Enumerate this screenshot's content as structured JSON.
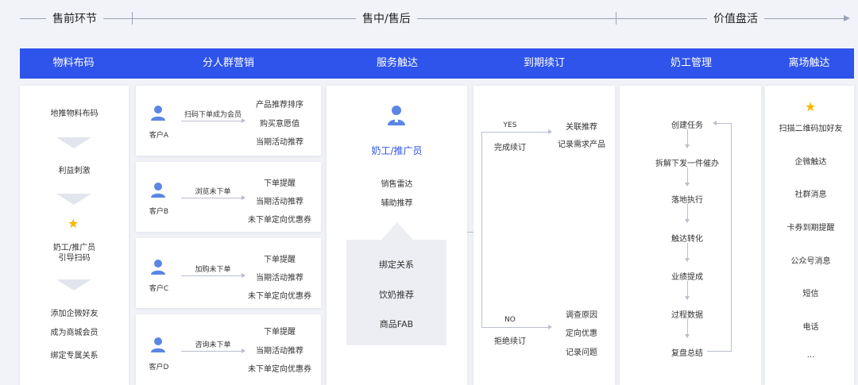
{
  "phases": {
    "pre": "售前环节",
    "mid": "售中/售后",
    "value": "价值盘活"
  },
  "headers": [
    "物料布码",
    "分人群营销",
    "服务触达",
    "到期续订",
    "奶工管理",
    "离场触达"
  ],
  "col1": {
    "step1": "地推物料布码",
    "step2": "利益刺激",
    "step3_line1": "奶工/推广员",
    "step3_line2": "引导扫码",
    "items": [
      "添加企微好友",
      "成为商城会员",
      "绑定专属关系"
    ]
  },
  "col2": {
    "groups": [
      {
        "customer": "客户A",
        "action": "扫码下单成为会员",
        "items": [
          "产品推荐排序",
          "购买意愿值",
          "当期活动推荐"
        ]
      },
      {
        "customer": "客户B",
        "action": "浏览未下单",
        "items": [
          "下单提醒",
          "当期活动推荐",
          "未下单定向优惠券"
        ]
      },
      {
        "customer": "客户C",
        "action": "加购未下单",
        "items": [
          "下单提醒",
          "当期活动推荐",
          "未下单定向优惠券"
        ]
      },
      {
        "customer": "客户D",
        "action": "咨询未下单",
        "items": [
          "下单提醒",
          "当期活动推荐",
          "未下单定向优惠券"
        ]
      }
    ]
  },
  "col3": {
    "role": "奶工/推广员",
    "items": [
      "销售雷达",
      "辅助推荐"
    ],
    "box_items": [
      "绑定关系",
      "饮奶推荐",
      "商品FAB"
    ]
  },
  "col4": {
    "yes_label": "YES",
    "yes_text": "完成续订",
    "yes_items": [
      "关联推荐",
      "记录需求产品"
    ],
    "no_label": "NO",
    "no_text": "拒绝续订",
    "no_items": [
      "调查原因",
      "定向优惠",
      "记录问题"
    ]
  },
  "col5": {
    "steps": [
      "创建任务",
      "拆解下发一件催办",
      "落地执行",
      "触达转化",
      "业绩提成",
      "过程数据",
      "复盘总结"
    ]
  },
  "col6": {
    "items": [
      "扫描二维码加好友",
      "企微触达",
      "社群消息",
      "卡券到期提醒",
      "公众号消息",
      "短信",
      "电话",
      "..."
    ]
  },
  "colors": {
    "accent": "#2f54eb",
    "star": "#f5b800",
    "person": "#5b86e5"
  }
}
